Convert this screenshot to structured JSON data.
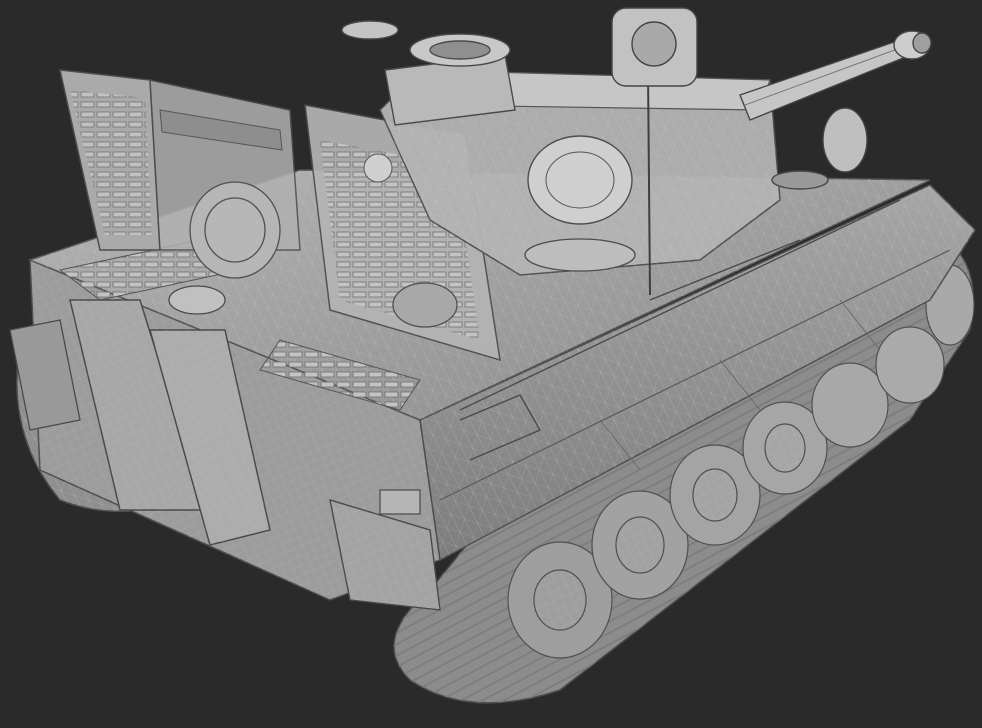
{
  "viewport": {
    "background": "#2a2a2a",
    "render_mode": "shaded-wireframe",
    "model_color": "#9a9a9a",
    "wire_color": "#d8d8d8"
  },
  "model": {
    "subject": "heavy tank",
    "parts": [
      "hull",
      "turret",
      "main-gun",
      "engine-deck",
      "exhaust-pipes",
      "tracks",
      "road-wheels",
      "open-hatches",
      "open-engine-grilles"
    ]
  }
}
